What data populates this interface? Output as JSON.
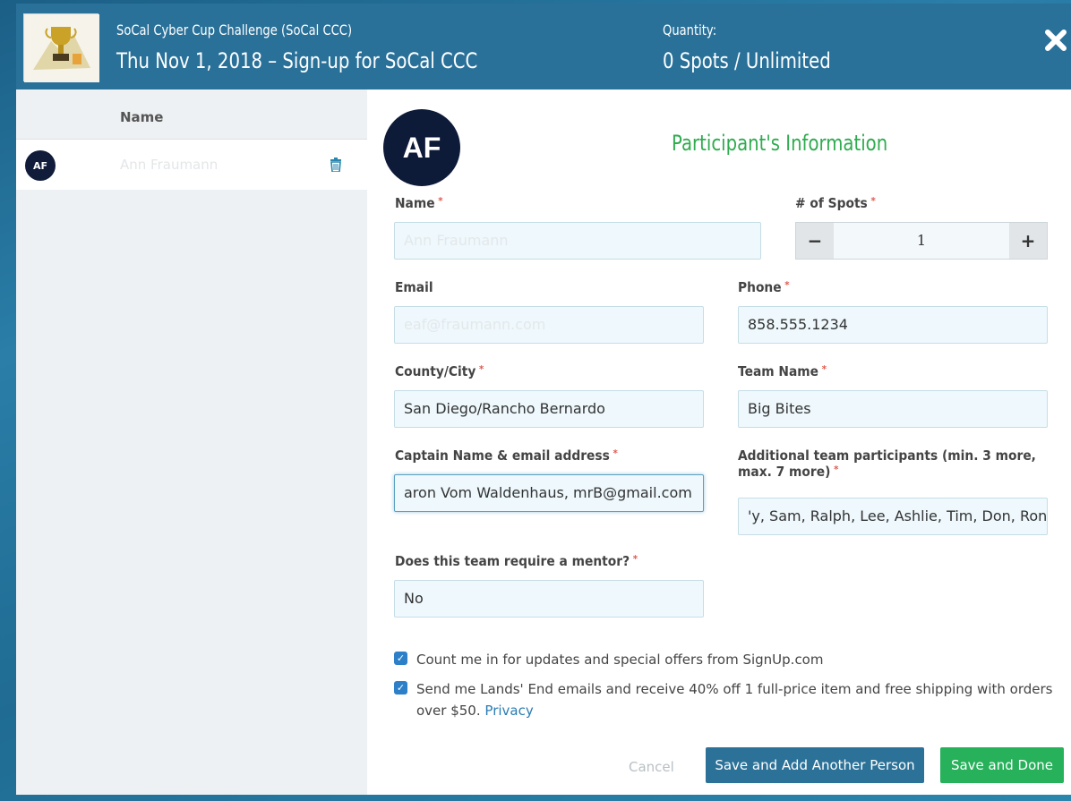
{
  "header": {
    "event_name": "SoCal Cyber Cup Challenge (SoCal CCC)",
    "event_date_title": "Thu Nov 1, 2018 – Sign-up for SoCal CCC",
    "quantity_label": "Quantity:",
    "quantity_value": "0 Spots / Unlimited",
    "close_icon": "close-icon"
  },
  "sidebar": {
    "column_header": "Name",
    "people": [
      {
        "initials": "AF",
        "name": "Ann Fraumann"
      }
    ]
  },
  "form": {
    "avatar_initials": "AF",
    "section_title": "Participant's Information",
    "name_label": "Name",
    "name_value": "Ann Fraumann",
    "spots_label": "# of Spots",
    "spots_value": "1",
    "spots_minus": "−",
    "spots_plus": "+",
    "email_label": "Email",
    "email_value": "eaf@fraumann.com",
    "phone_label": "Phone",
    "phone_value": "858.555.1234",
    "county_label": "County/City",
    "county_value": "San  Diego/Rancho Bernardo",
    "team_label": "Team Name",
    "team_value": "Big Bites",
    "captain_label": "Captain Name & email address",
    "captain_value": "aron Vom Waldenhaus, mrB@gmail.com",
    "additional_label_line1": "Additional team participants (min. 3 more,",
    "additional_label_line2": "max. 7 more)",
    "additional_value": "'y, Sam, Ralph, Lee, Ashlie, Tim, Don, Ron",
    "mentor_label": "Does this team require a mentor?",
    "mentor_value": "No",
    "required_mark": "*"
  },
  "checks": {
    "updates_text": "Count me in for updates and special offers from SignUp.com",
    "landsend_text": "Send me Lands' End emails and receive 40% off 1 full-price item and free shipping with orders over $50.",
    "privacy_link": "Privacy"
  },
  "buttons": {
    "cancel": "Cancel",
    "save_add": "Save and Add Another Person",
    "save_done": "Save and Done"
  },
  "colors": {
    "header_bg": "#2a7199",
    "title_green": "#2fab4f",
    "primary_button": "#2c7198",
    "done_button": "#27b15b",
    "avatar": "#0d1a38"
  }
}
